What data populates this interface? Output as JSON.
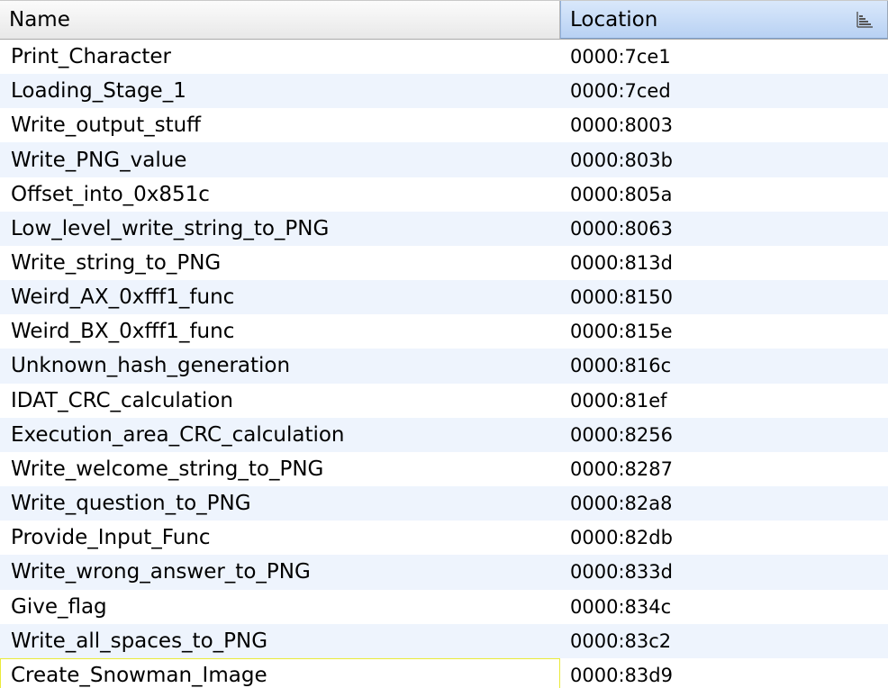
{
  "columns": {
    "name": "Name",
    "location": "Location"
  },
  "icons": {
    "sort": "sort-ascending-icon"
  },
  "rows": [
    {
      "name": "Print_Character",
      "location": "0000:7ce1"
    },
    {
      "name": "Loading_Stage_1",
      "location": "0000:7ced"
    },
    {
      "name": "Write_output_stuff",
      "location": "0000:8003"
    },
    {
      "name": "Write_PNG_value",
      "location": "0000:803b"
    },
    {
      "name": "Offset_into_0x851c",
      "location": "0000:805a"
    },
    {
      "name": "Low_level_write_string_to_PNG",
      "location": "0000:8063"
    },
    {
      "name": "Write_string_to_PNG",
      "location": "0000:813d"
    },
    {
      "name": "Weird_AX_0xfff1_func",
      "location": "0000:8150"
    },
    {
      "name": "Weird_BX_0xfff1_func",
      "location": "0000:815e"
    },
    {
      "name": "Unknown_hash_generation",
      "location": "0000:816c"
    },
    {
      "name": "IDAT_CRC_calculation",
      "location": "0000:81ef"
    },
    {
      "name": "Execution_area_CRC_calculation",
      "location": "0000:8256"
    },
    {
      "name": "Write_welcome_string_to_PNG",
      "location": "0000:8287"
    },
    {
      "name": "Write_question_to_PNG",
      "location": "0000:82a8"
    },
    {
      "name": "Provide_Input_Func",
      "location": "0000:82db"
    },
    {
      "name": "Write_wrong_answer_to_PNG",
      "location": "0000:833d"
    },
    {
      "name": "Give_flag",
      "location": "0000:834c"
    },
    {
      "name": "Write_all_spaces_to_PNG",
      "location": "0000:83c2"
    },
    {
      "name": "Create_Snowman_Image",
      "location": "0000:83d9"
    }
  ]
}
